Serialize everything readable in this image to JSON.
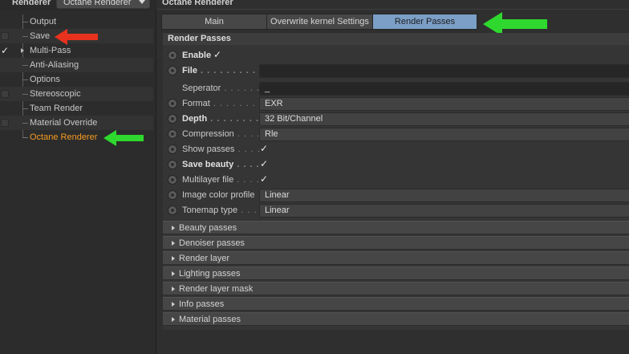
{
  "left_panel": {
    "renderer_label": "Renderer",
    "renderer_value": "Octane Renderer",
    "items": [
      {
        "label": "Output"
      },
      {
        "label": "Save"
      },
      {
        "label": "Multi-Pass"
      },
      {
        "label": "Anti-Aliasing"
      },
      {
        "label": "Options"
      },
      {
        "label": "Stereoscopic"
      },
      {
        "label": "Team Render"
      },
      {
        "label": "Material Override"
      },
      {
        "label": "Octane Renderer"
      }
    ]
  },
  "right_panel": {
    "title": "Octane Renderer",
    "tabs": [
      {
        "label": "Main"
      },
      {
        "label": "Overwrite kernel Settings"
      },
      {
        "label": "Render Passes"
      }
    ],
    "section_title": "Render Passes",
    "fields": {
      "enable": {
        "label": "Enable",
        "checked": true
      },
      "file": {
        "label": "File",
        "dots": " . . . . . . . . . . . .",
        "value": ""
      },
      "separator": {
        "label": "Seperator",
        "dots": " . . . . . . .",
        "value": "_"
      },
      "format": {
        "label": "Format",
        "dots": " . . . . . . . . . .",
        "value": "EXR"
      },
      "depth": {
        "label": "Depth",
        "dots": " . . . . . . . . . . .",
        "value": "32 Bit/Channel"
      },
      "compression": {
        "label": "Compression",
        "dots": " . . . .",
        "value": "Rle"
      },
      "show_passes": {
        "label": "Show passes",
        "dots": " . . . .",
        "checked": true
      },
      "save_beauty": {
        "label": "Save beauty",
        "dots": " . . . .",
        "checked": true
      },
      "multilayer_file": {
        "label": "Multilayer file",
        "dots": " . . . .",
        "checked": true
      },
      "image_color_profile": {
        "label": "Image color profile",
        "value": "Linear"
      },
      "tonemap_type": {
        "label": "Tonemap type",
        "dots": " . . .",
        "value": "Linear"
      }
    },
    "groups": [
      {
        "label": "Beauty passes"
      },
      {
        "label": "Denoiser passes"
      },
      {
        "label": "Render layer"
      },
      {
        "label": "Lighting passes"
      },
      {
        "label": "Render layer mask"
      },
      {
        "label": "Info passes"
      },
      {
        "label": "Material passes"
      }
    ]
  },
  "colors": {
    "accent_selected_text": "#f59b21",
    "active_tab": "#7b9fc7",
    "annotation_red": "#e8321e",
    "annotation_green": "#2ed82e"
  },
  "icons": {
    "check": "✓",
    "checkbox": "checkbox-icon",
    "expand": "triangle-right-icon",
    "dropdown": "chevron-down-icon",
    "annotation_arrow": "arrow-icon"
  }
}
